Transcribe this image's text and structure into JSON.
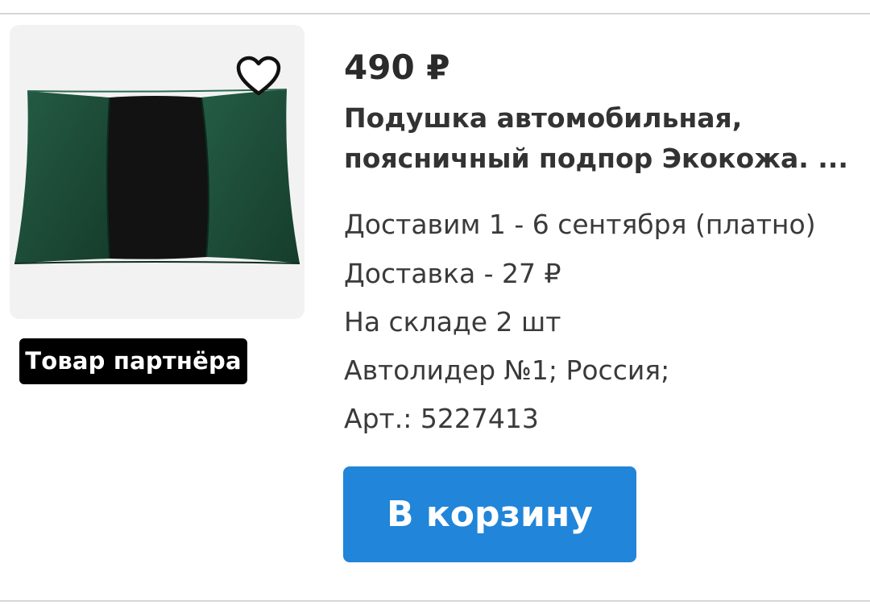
{
  "product": {
    "price": "490 ₽",
    "title_lines": [
      "Подушка автомобильная,",
      "поясничный подпор Экокожа. ..."
    ],
    "delivery_dates": "Доставим 1 - 6 сентября (платно)",
    "delivery_cost": "Доставка - 27 ₽",
    "stock": "На складе 2 шт",
    "seller": "Автолидер №1; Россия;",
    "article": "Арт.: 5227413",
    "partner_badge": "Товар партнёра",
    "image_icon": "pillow-image",
    "favorite_icon": "heart-outline-icon"
  },
  "actions": {
    "add_to_cart": "В корзину"
  },
  "colors": {
    "accent": "#2185d9",
    "badge_bg": "#000000",
    "pillow_green": "#1f4f3a",
    "pillow_black": "#111111"
  }
}
